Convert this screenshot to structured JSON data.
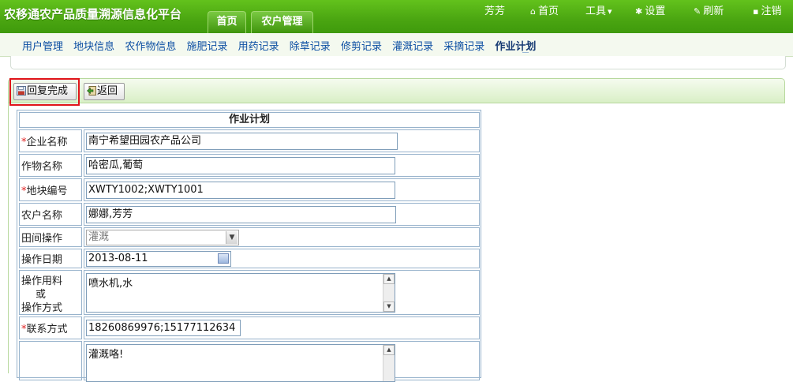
{
  "header": {
    "app_title": "农移通农产品质量溯源信息化平台",
    "tabs": [
      {
        "label": "首页"
      },
      {
        "label": "农户管理"
      }
    ],
    "user": "芳芳",
    "links": {
      "home": "首页",
      "tools": "工具",
      "settings": "设置",
      "refresh": "刷新",
      "logout": "注销"
    }
  },
  "subnav": {
    "items": [
      {
        "label": "用户管理"
      },
      {
        "label": "地块信息"
      },
      {
        "label": "农作物信息"
      },
      {
        "label": "施肥记录"
      },
      {
        "label": "用药记录"
      },
      {
        "label": "除草记录"
      },
      {
        "label": "修剪记录"
      },
      {
        "label": "灌溉记录"
      },
      {
        "label": "采摘记录"
      },
      {
        "label": "作业计划"
      }
    ],
    "active_index": 9
  },
  "toolbar": {
    "complete_label": "回复完成",
    "back_label": "返回"
  },
  "form": {
    "title": "作业计划",
    "company": {
      "label": "企业名称",
      "value": "南宁希望田园农产品公司"
    },
    "crop": {
      "label": "作物名称",
      "value": "哈密瓜,葡萄"
    },
    "plot": {
      "label": "地块编号",
      "value": "XWTY1002;XWTY1001"
    },
    "farmer": {
      "label": "农户名称",
      "value": "娜娜,芳芳"
    },
    "operation": {
      "label": "田间操作",
      "value": "灌溉"
    },
    "date": {
      "label": "操作日期",
      "value": "2013-08-11"
    },
    "material": {
      "label_line1": "操作用料",
      "label_line2": "或",
      "label_line3": "操作方式",
      "value": "喷水机,水"
    },
    "contact": {
      "label": "联系方式",
      "value": "18260869976;15177112634"
    },
    "remark": {
      "value": "灌溉咯!"
    }
  },
  "colors": {
    "header_green": "#4aa511",
    "nav_link": "#0d4fa3",
    "required_mark": "#e02020",
    "highlight": "#e0141a"
  }
}
